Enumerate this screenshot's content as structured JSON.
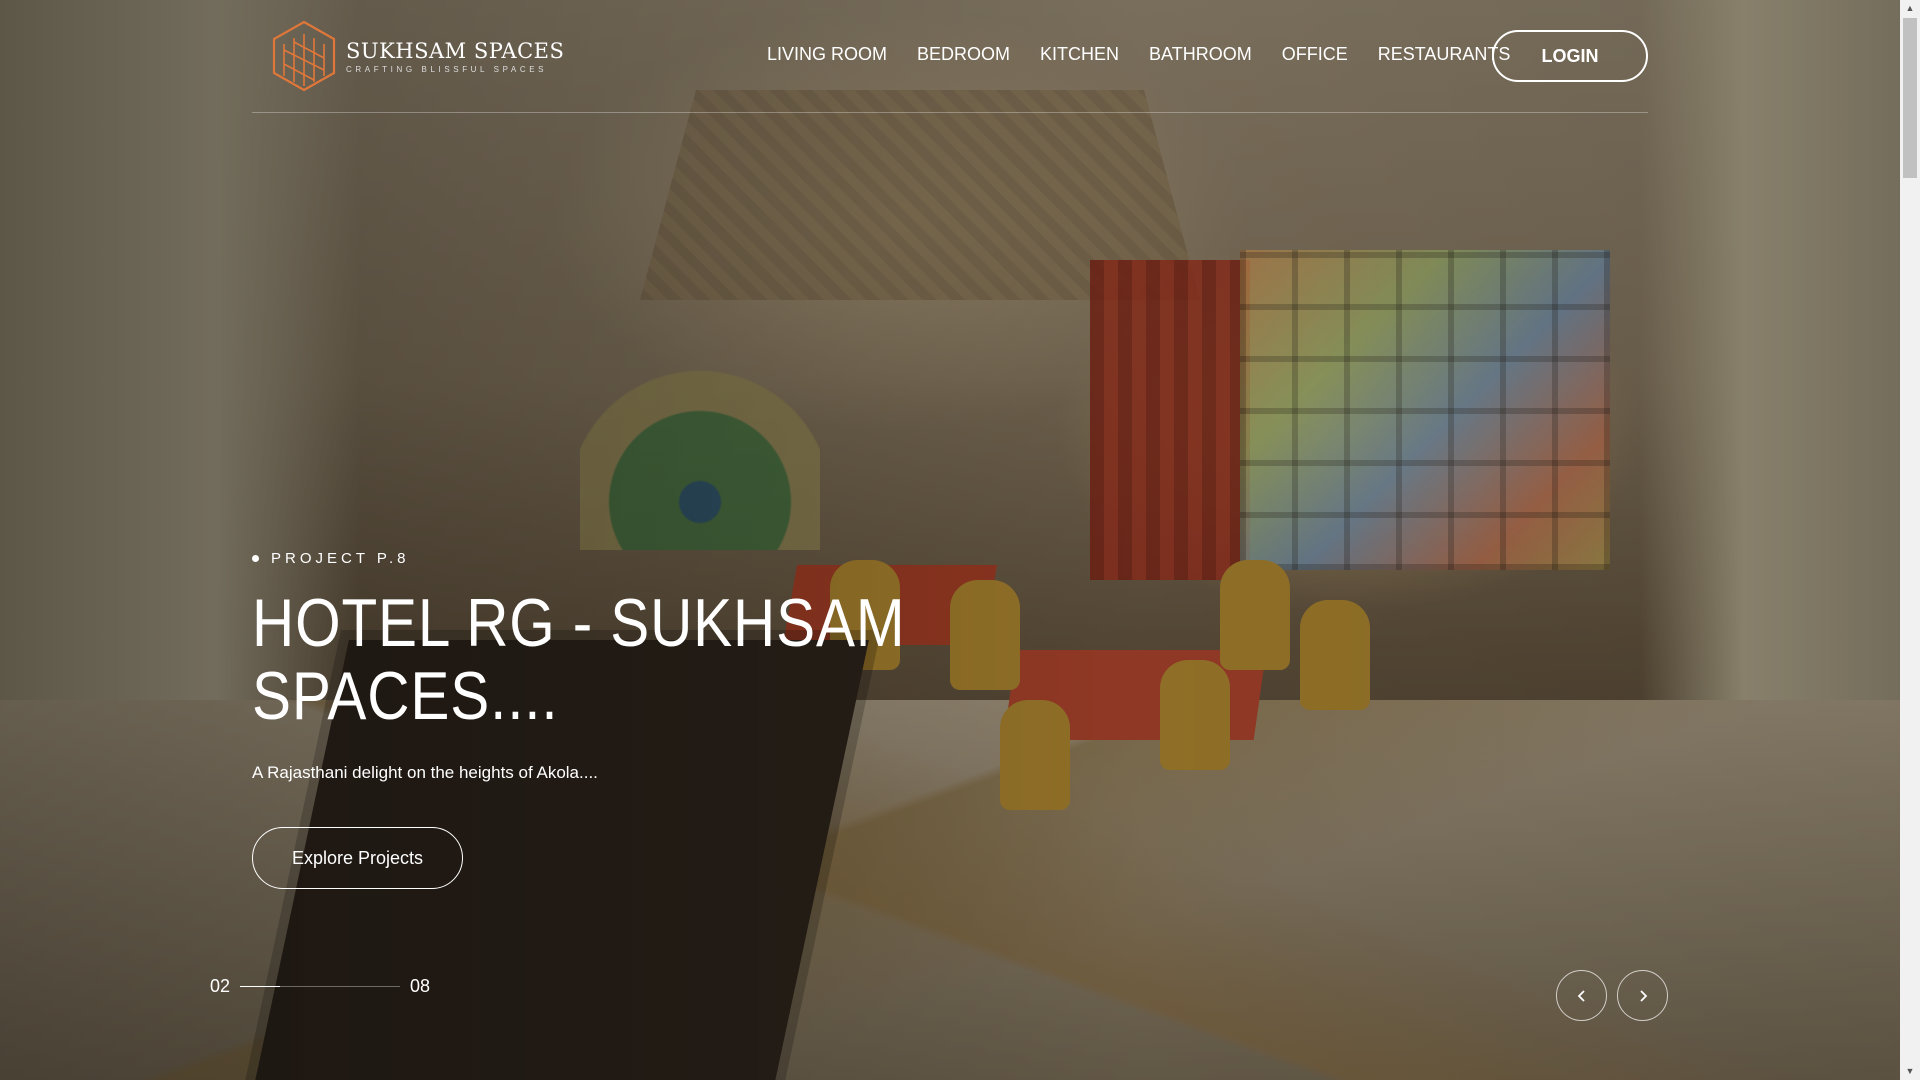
{
  "brand": {
    "name": "SUKHSAM SPACES",
    "tagline": "CRAFTING BLISSFUL SPACES",
    "accent_color": "#e0773a"
  },
  "nav": {
    "items": [
      {
        "label": "LIVING ROOM"
      },
      {
        "label": "BEDROOM"
      },
      {
        "label": "KITCHEN"
      },
      {
        "label": "BATHROOM"
      },
      {
        "label": "OFFICE"
      },
      {
        "label": "RESTAURANTS"
      }
    ],
    "login_label": "LOGIN"
  },
  "hero": {
    "eyebrow": "PROJECT P.8",
    "title": "HOTEL RG - SUKHSAM SPACES....",
    "subtitle": "A Rajasthani delight on the heights of Akola....",
    "cta_label": "Explore Projects"
  },
  "slider": {
    "current": "02",
    "total": "08",
    "progress": 0.25,
    "prev_icon": "chevron-left-icon",
    "next_icon": "chevron-right-icon"
  }
}
